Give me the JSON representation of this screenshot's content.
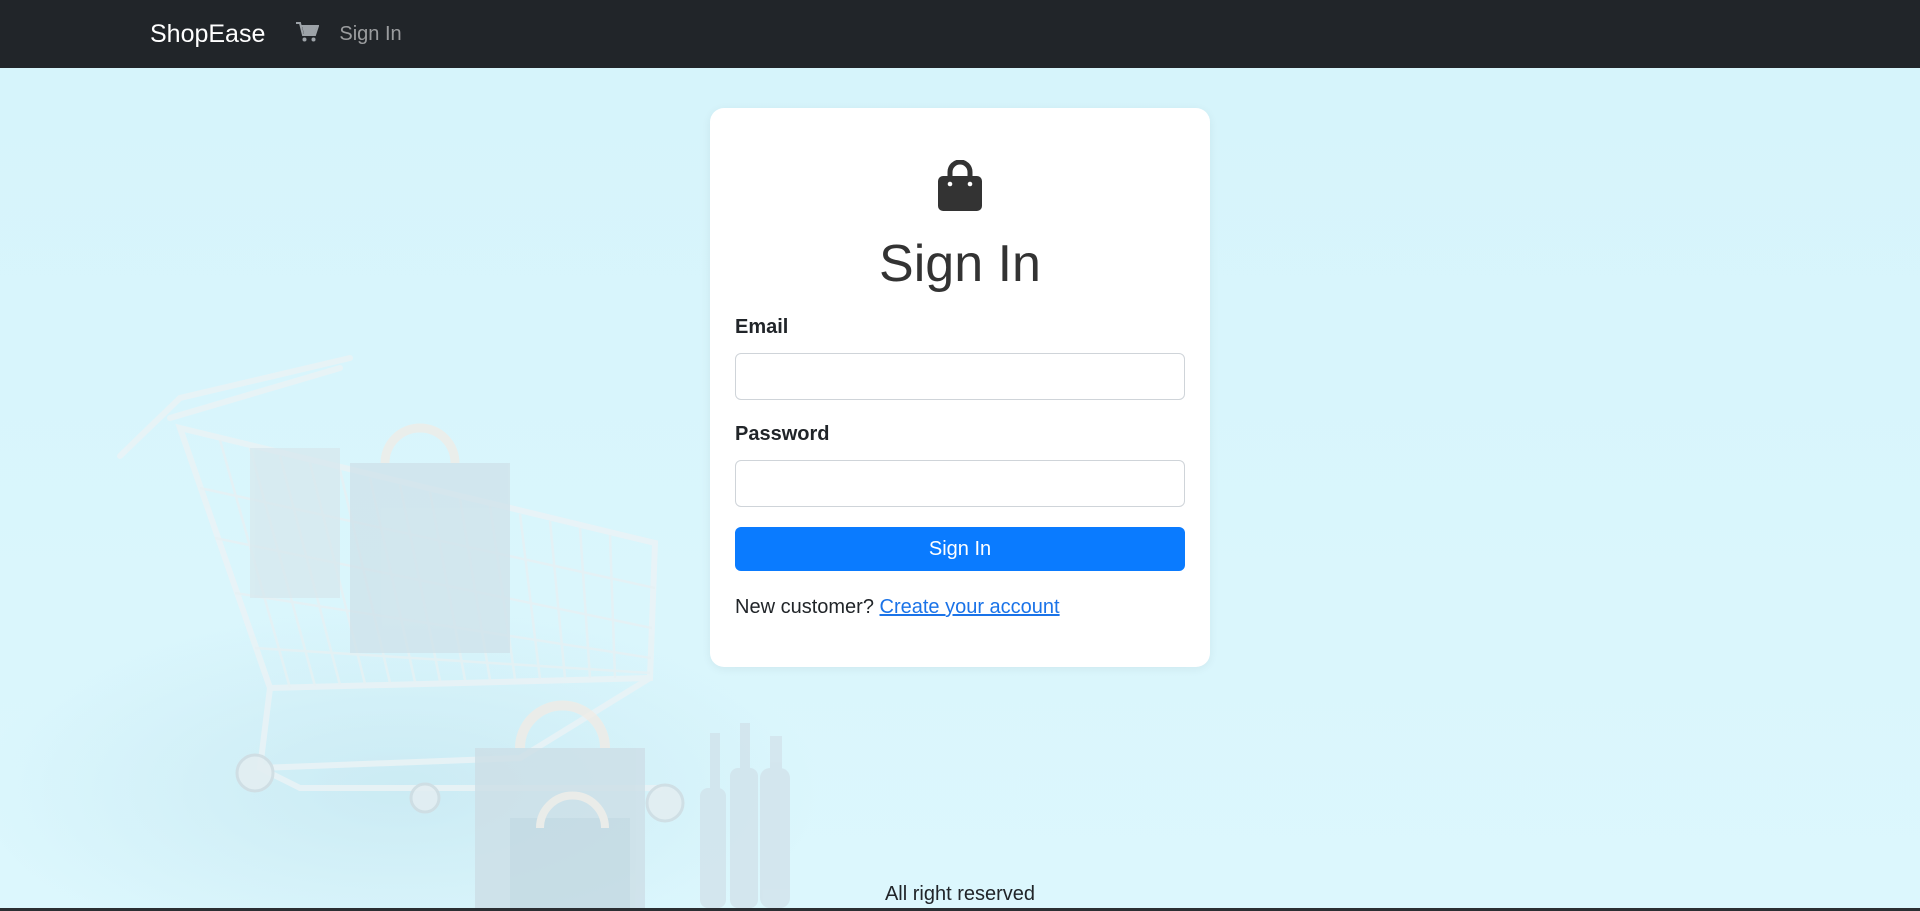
{
  "navbar": {
    "brand": "ShopEase",
    "cart_icon": "cart-icon",
    "signin_link": "Sign In"
  },
  "background": {
    "description_icon": "shopping-cart-illustration"
  },
  "login_card": {
    "icon": "shopping-bag-icon",
    "title": "Sign In",
    "email_label": "Email",
    "email_value": "",
    "password_label": "Password",
    "password_value": "",
    "submit_label": "Sign In",
    "register_prompt": "New customer?",
    "register_link": "Create your account"
  },
  "footer": {
    "text": "All right reserved"
  },
  "colors": {
    "navbar_bg": "#212529",
    "page_bg": "#d9f5fc",
    "primary_button": "#0a7bff",
    "link": "#1a73e8"
  }
}
